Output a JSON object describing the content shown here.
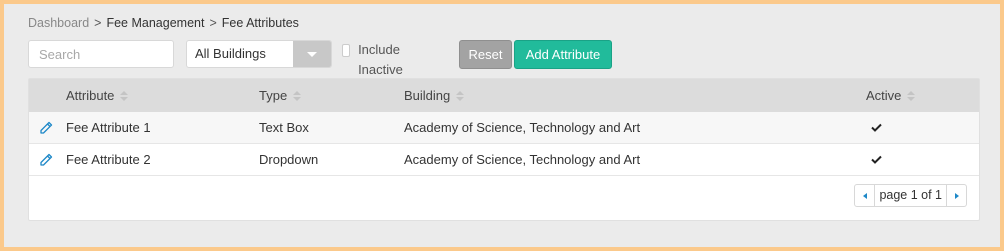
{
  "breadcrumb": {
    "items": [
      "Dashboard",
      "Fee Management",
      "Fee Attributes"
    ],
    "separator": ">"
  },
  "toolbar": {
    "search_placeholder": "Search",
    "search_value": "",
    "building_select": "All Buildings",
    "include_inactive_label": "Include Inactive",
    "include_inactive_checked": false,
    "reset_label": "Reset",
    "add_label": "Add Attribute"
  },
  "table": {
    "columns": [
      "Attribute",
      "Type",
      "Building",
      "Active"
    ],
    "rows": [
      {
        "attribute": "Fee Attribute 1",
        "type": "Text Box",
        "building": "Academy of Science, Technology and Art",
        "active": true
      },
      {
        "attribute": "Fee Attribute 2",
        "type": "Dropdown",
        "building": "Academy of Science, Technology and Art",
        "active": true
      }
    ]
  },
  "pagination": {
    "label": "page 1 of 1"
  },
  "colors": {
    "accent": "#21bb9b",
    "reset": "#a3a3a3",
    "pager_arrow": "#1e88c8",
    "edit_icon": "#1e88c8",
    "page_border": "#fbc98b"
  },
  "icons": {
    "edit": "pencil-icon",
    "active": "checkmark-icon",
    "sort": "sort-icon",
    "prev": "chevron-left-icon",
    "next": "chevron-right-icon",
    "select": "chevron-down-icon"
  }
}
